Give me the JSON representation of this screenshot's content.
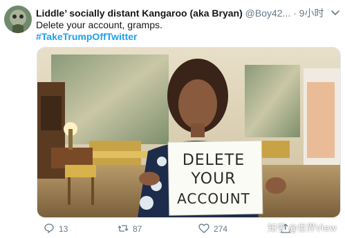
{
  "author": {
    "display_name": "Liddle’ socially distant Kangaroo (aka Bryan)",
    "handle": "@Boy42...",
    "separator": "·",
    "time": "9小时"
  },
  "tweet": {
    "text": "Delete your account, gramps.",
    "hashtag": "#TakeTrumpOffTwitter"
  },
  "media": {
    "sign_line1": "DELETE",
    "sign_line2": "YOUR",
    "sign_line3": "ACCOUNT"
  },
  "actions": {
    "replies": "13",
    "retweets": "87",
    "likes": "274"
  },
  "watermark": "知乎 @世界View",
  "colors": {
    "link": "#1da1f2",
    "text": "#14171a",
    "muted": "#657786"
  },
  "icons": {
    "reply": "reply-icon",
    "retweet": "retweet-icon",
    "like": "heart-icon",
    "share": "share-icon",
    "menu": "chevron-down-icon"
  }
}
